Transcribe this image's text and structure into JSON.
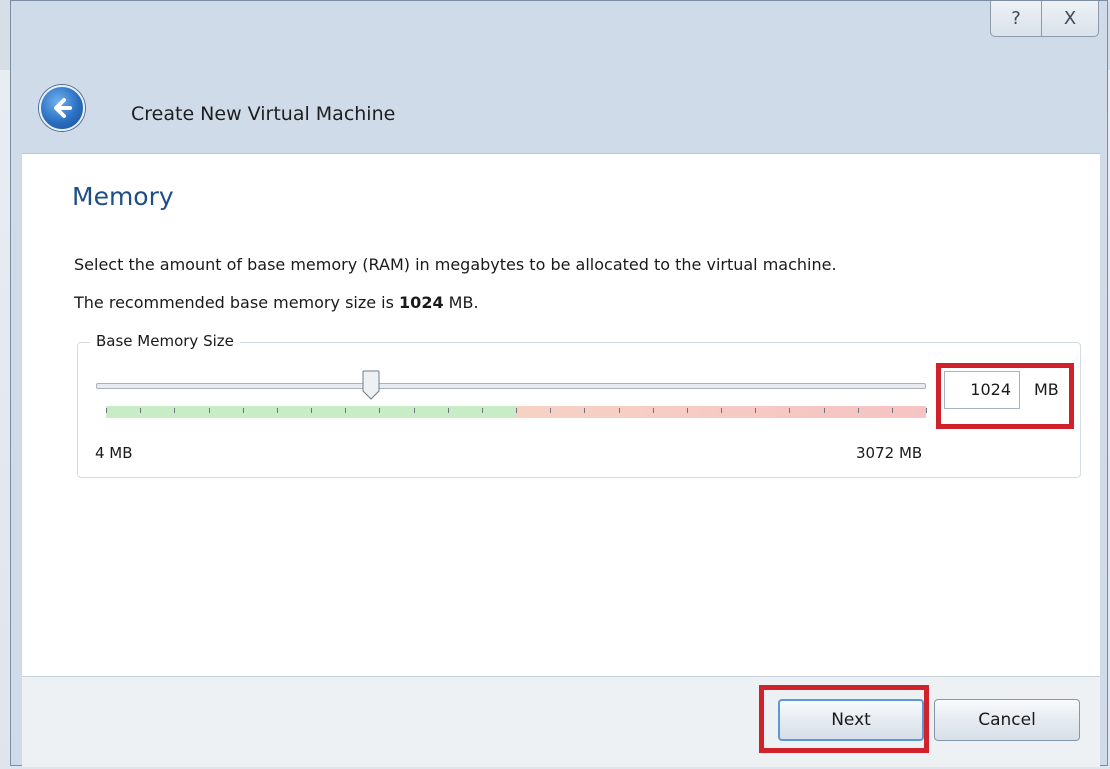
{
  "window": {
    "title": "Create New Virtual Machine",
    "help_glyph": "?",
    "close_glyph": "X"
  },
  "page": {
    "heading": "Memory",
    "description": "Select the amount of base memory (RAM) in megabytes to be allocated to the virtual machine.",
    "recommend_prefix": "The recommended base memory size is ",
    "recommend_value": "1024",
    "recommend_suffix": " MB."
  },
  "memory": {
    "group_label": "Base Memory Size",
    "min_label": "4 MB",
    "max_label": "3072 MB",
    "value": "1024",
    "unit": "MB",
    "slider_min": 4,
    "slider_max": 3072,
    "slider_value": 1024,
    "safe_fraction": 0.5
  },
  "footer": {
    "next_label": "Next",
    "cancel_label": "Cancel"
  },
  "colors": {
    "heading": "#1f4d86",
    "highlight": "#d1222c",
    "safe_zone": "#c8edc6",
    "warn_zone": "#f5c3c3"
  }
}
